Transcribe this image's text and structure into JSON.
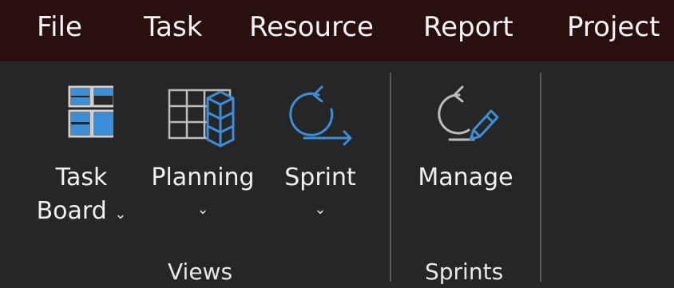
{
  "menu": {
    "items": [
      "File",
      "Task",
      "Resource",
      "Report",
      "Project"
    ]
  },
  "ribbon": {
    "groups": [
      {
        "label": "Views",
        "buttons": [
          {
            "line1": "Task",
            "line2": "Board",
            "chevron": "⌄",
            "icon": "task-board-icon"
          },
          {
            "line1": "Planning",
            "chevron": "⌄",
            "icon": "planning-icon"
          },
          {
            "line1": "Sprint",
            "chevron": "⌄",
            "icon": "sprint-icon"
          }
        ]
      },
      {
        "label": "Sprints",
        "buttons": [
          {
            "line1": "Manage",
            "icon": "manage-sprints-icon"
          }
        ]
      }
    ]
  },
  "colors": {
    "menubar_bg": "#2a0f0f",
    "ribbon_bg": "#262626",
    "accent_blue": "#3b8ed8",
    "icon_gray": "#bdbdbd"
  }
}
